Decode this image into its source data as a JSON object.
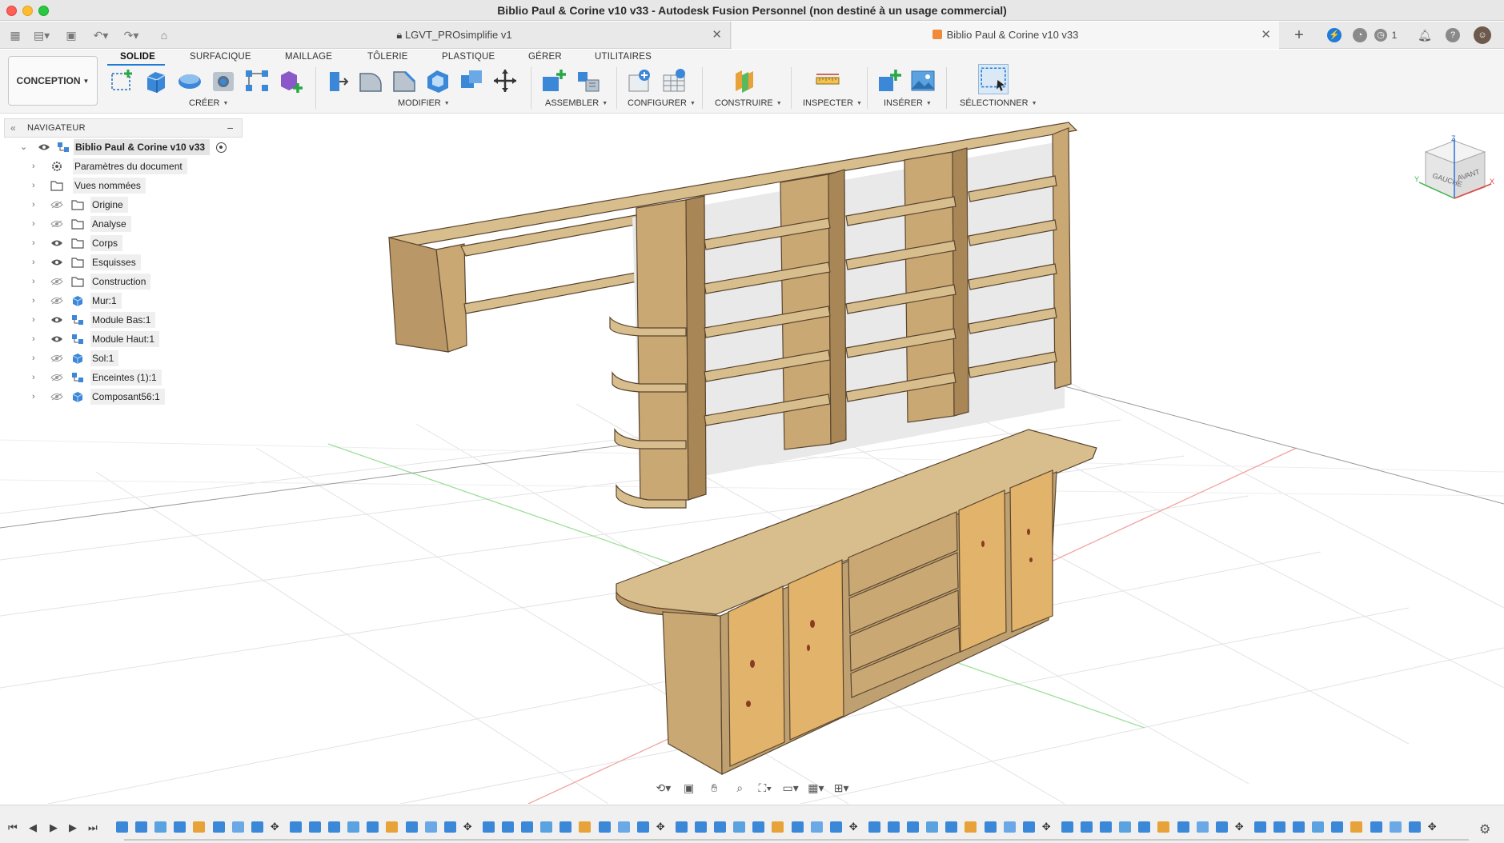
{
  "window": {
    "title": "Biblio Paul & Corine v10 v33 - Autodesk Fusion Personnel (non destiné à un usage commercial)"
  },
  "tabs": [
    {
      "label": "LGVT_PROsimplifie v1",
      "active": false
    },
    {
      "label": "Biblio Paul & Corine v10 v33",
      "active": true
    }
  ],
  "status": {
    "job_count": "1"
  },
  "workspace": {
    "label": "CONCEPTION"
  },
  "ribbon_tabs": [
    {
      "label": "SOLIDE",
      "active": true
    },
    {
      "label": "SURFACIQUE"
    },
    {
      "label": "MAILLAGE"
    },
    {
      "label": "TÔLERIE"
    },
    {
      "label": "PLASTIQUE"
    },
    {
      "label": "GÉRER"
    },
    {
      "label": "UTILITAIRES"
    }
  ],
  "groups": {
    "creer": "CRÉER",
    "modifier": "MODIFIER",
    "assembler": "ASSEMBLER",
    "configurer": "CONFIGURER",
    "construire": "CONSTRUIRE",
    "inspecter": "INSPECTER",
    "inserer": "INSÉRER",
    "selectionner": "SÉLECTIONNER"
  },
  "navigator": {
    "title": "NAVIGATEUR",
    "root": "Biblio Paul & Corine v10 v33",
    "items": [
      {
        "label": "Paramètres du document",
        "icon": "gear-icon",
        "eye": "none"
      },
      {
        "label": "Vues nommées",
        "icon": "folder-icon",
        "eye": "none"
      },
      {
        "label": "Origine",
        "icon": "folder-icon",
        "eye": "hidden"
      },
      {
        "label": "Analyse",
        "icon": "folder-icon",
        "eye": "hidden"
      },
      {
        "label": "Corps",
        "icon": "folder-icon",
        "eye": "visible"
      },
      {
        "label": "Esquisses",
        "icon": "folder-icon",
        "eye": "visible"
      },
      {
        "label": "Construction",
        "icon": "folder-icon",
        "eye": "hidden"
      },
      {
        "label": "Mur:1",
        "icon": "body-icon",
        "eye": "hidden"
      },
      {
        "label": "Module Bas:1",
        "icon": "component-icon",
        "eye": "visible"
      },
      {
        "label": "Module Haut:1",
        "icon": "component-icon",
        "eye": "visible"
      },
      {
        "label": "Sol:1",
        "icon": "body-icon",
        "eye": "hidden"
      },
      {
        "label": "Enceintes (1):1",
        "icon": "component-icon",
        "eye": "hidden"
      },
      {
        "label": "Composant56:1",
        "icon": "body-icon",
        "eye": "hidden"
      }
    ]
  },
  "viewcube": {
    "left": "GAUCHE",
    "front": "AVANT",
    "axis_x": "X",
    "axis_y": "Y",
    "axis_z": "Z"
  },
  "colors": {
    "accent": "#1e7bd7",
    "wood": "#c9a874",
    "wood_dark": "#a88656",
    "panel": "#d9a95c"
  }
}
